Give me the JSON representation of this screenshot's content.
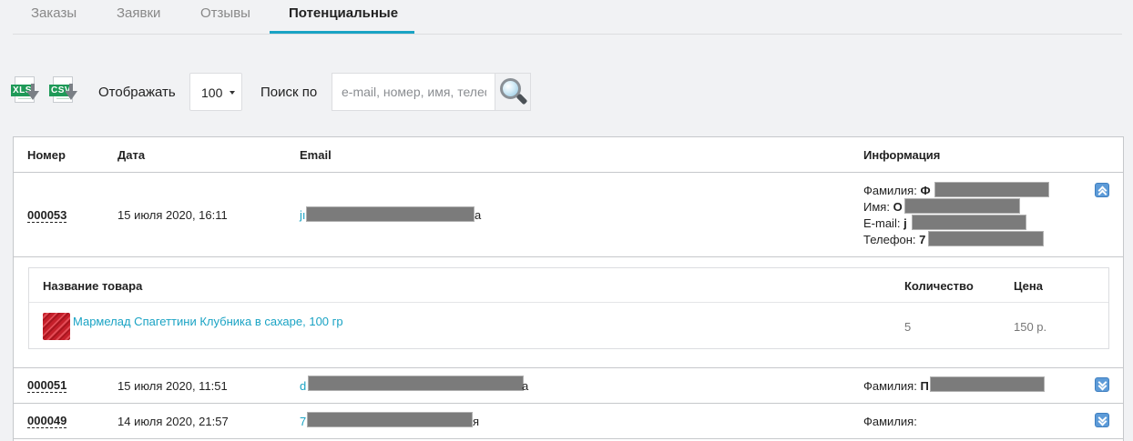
{
  "tabs": [
    {
      "label": "Заказы",
      "active": false
    },
    {
      "label": "Заявки",
      "active": false
    },
    {
      "label": "Отзывы",
      "active": false
    },
    {
      "label": "Потенциальные",
      "active": true
    }
  ],
  "toolbar": {
    "xls_label": "XLS",
    "csv_label": "CSV",
    "show_label": "Отображать",
    "show_value": "100",
    "search_label": "Поиск по",
    "search_placeholder": "e-mail, номер, имя, телефон"
  },
  "table": {
    "headers": {
      "number": "Номер",
      "date": "Дата",
      "email": "Email",
      "info": "Информация"
    },
    "rows": [
      {
        "number": "000053",
        "date": "15 июля 2020, 16:11",
        "email_start": "jı",
        "email_end": "a",
        "expanded": true,
        "info": [
          {
            "label": "Фамилия:",
            "value_start": "Ф"
          },
          {
            "label": "Имя:",
            "value_start": "O"
          },
          {
            "label": "E-mail:",
            "value_start": "j"
          },
          {
            "label": "Телефон:",
            "value_start": "7"
          }
        ],
        "products": {
          "headers": {
            "name": "Название товара",
            "qty": "Количество",
            "price": "Цена"
          },
          "items": [
            {
              "name": "Мармелад Спагеттини Клубника в сахаре, 100 гр",
              "qty": "5",
              "price": "150 р."
            }
          ]
        }
      },
      {
        "number": "000051",
        "date": "15 июля 2020, 11:51",
        "email_start": "d",
        "email_end": "a",
        "expanded": false,
        "info": [
          {
            "label": "Фамилия:",
            "value_start": "П"
          }
        ]
      },
      {
        "number": "000049",
        "date": "14 июля 2020, 21:57",
        "email_start": "7",
        "email_end": "я",
        "expanded": false,
        "info": [
          {
            "label": "Фамилия:",
            "value_start": ""
          }
        ]
      }
    ]
  },
  "colors": {
    "accent": "#1aa3c4",
    "toggle": "#5d9bd8",
    "redaction": "#7b7b7b"
  }
}
